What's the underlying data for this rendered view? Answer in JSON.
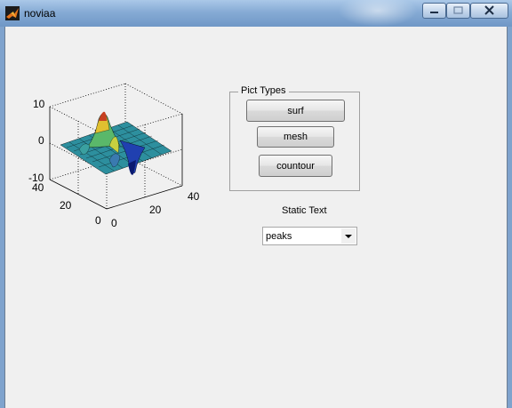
{
  "window": {
    "title": "noviaa"
  },
  "plot": {
    "z_ticks": [
      "10",
      "0",
      "-10"
    ],
    "y_ticks": [
      "40",
      "20",
      "0"
    ],
    "x_ticks": [
      "0",
      "20",
      "40"
    ]
  },
  "panel": {
    "title": "Pict Types",
    "buttons": [
      "surf",
      "mesh",
      "countour"
    ]
  },
  "static_text": "Static Text",
  "popup": {
    "value": "peaks"
  }
}
